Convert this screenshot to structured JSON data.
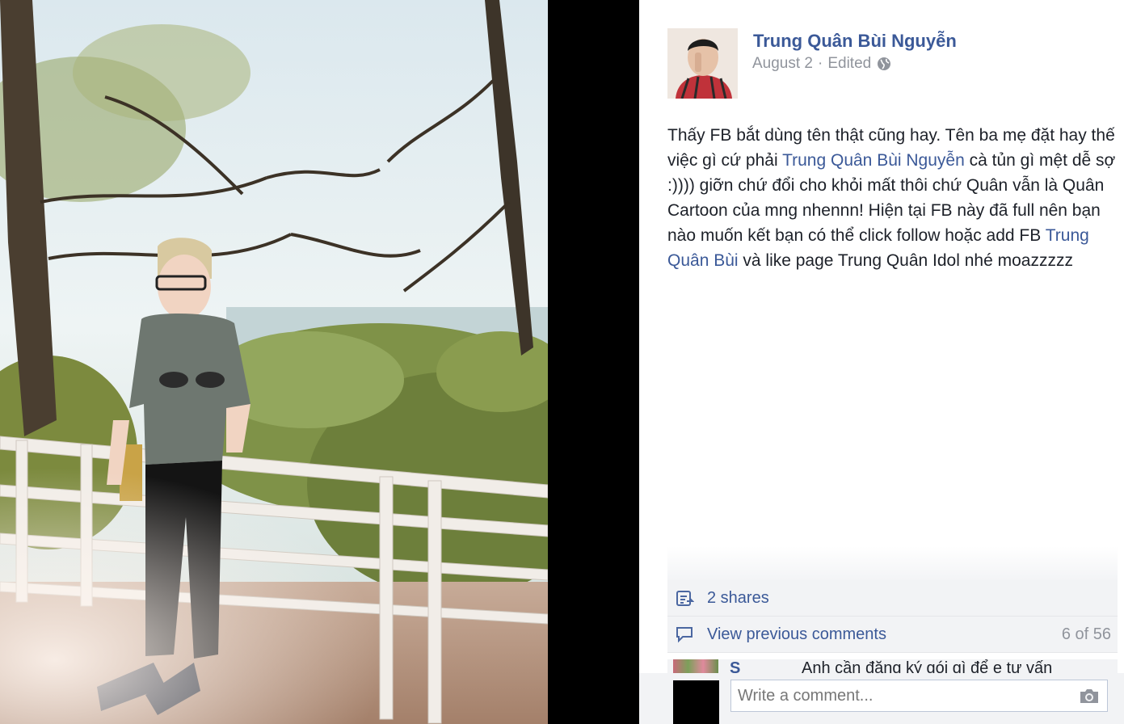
{
  "post": {
    "author": "Trung Quân Bùi Nguyễn",
    "date": "August 2",
    "separator": "·",
    "edited": "Edited",
    "text": {
      "part1": "Thấy FB bắt dùng tên thật cũng hay. Tên ba mẹ đặt hay thế việc gì cứ phải ",
      "link1": "Trung Quân Bùi Nguyễn",
      "part2": " cà tủn gì mệt dễ sợ :)))) giỡn chứ đổi cho khỏi mất thôi chứ Quân vẫn là Quân Cartoon của mng nhennn! Hiện tại FB này đã full nên bạn nào muốn kết bạn có thể click follow hoặc add FB ",
      "link2": "Trung Quân Bùi",
      "part3": " và like page Trung Quân Idol nhé moazzzzz"
    }
  },
  "ufi": {
    "shares": "2 shares",
    "view_previous": "View previous comments",
    "comment_count": "6 of 56"
  },
  "comment_preview": {
    "name": "S",
    "text": "Anh cần đăng ký gói gì để e tư vấn"
  },
  "composer": {
    "placeholder": "Write a comment..."
  },
  "icons": {
    "privacy": "globe-icon",
    "shares": "share-icon",
    "comments": "comment-icon",
    "attach": "camera-icon"
  },
  "colors": {
    "link": "#3b5998",
    "meta": "#90949c",
    "ufi_bg": "#f2f3f5"
  }
}
